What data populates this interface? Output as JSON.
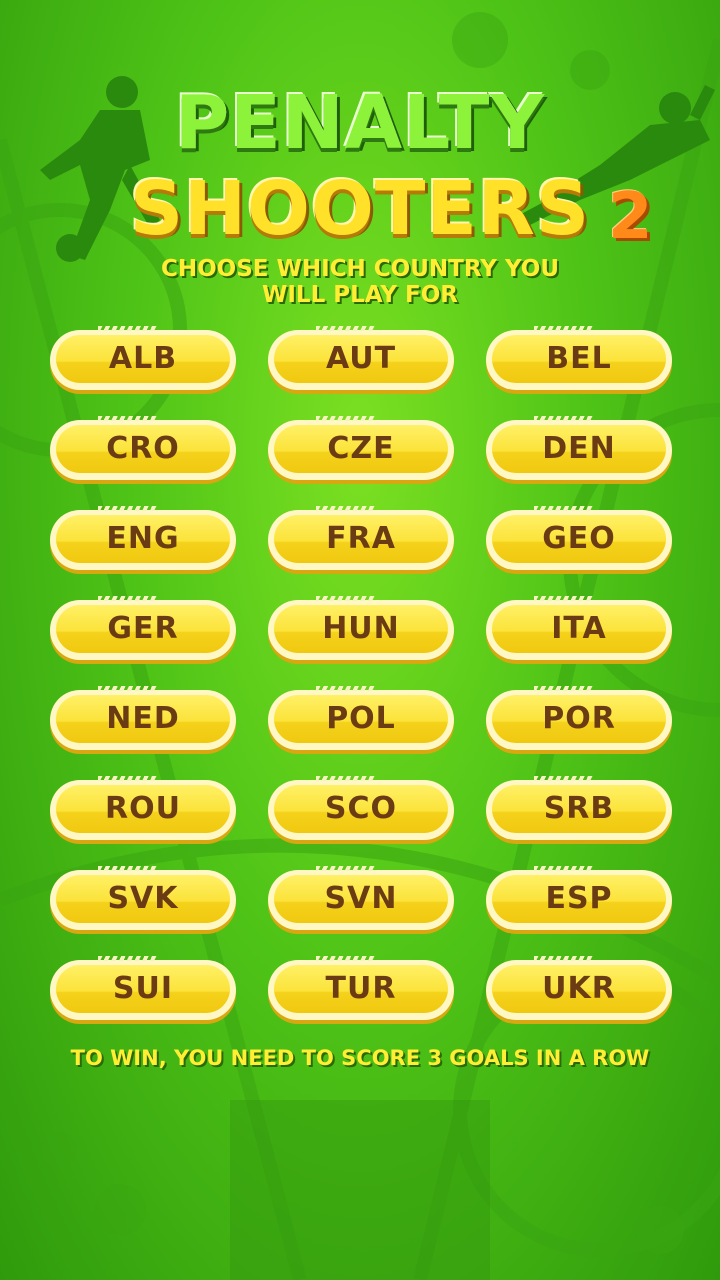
{
  "title": {
    "line1": "PENALTY",
    "line2": "SHOOTERS",
    "number": "2"
  },
  "subtitle_line1": "CHOOSE WHICH COUNTRY YOU",
  "subtitle_line2": "WILL PLAY FOR",
  "countries": [
    "ALB",
    "AUT",
    "BEL",
    "CRO",
    "CZE",
    "DEN",
    "ENG",
    "FRA",
    "GEO",
    "GER",
    "HUN",
    "ITA",
    "NED",
    "POL",
    "POR",
    "ROU",
    "SCO",
    "SRB",
    "SVK",
    "SVN",
    "ESP",
    "SUI",
    "TUR",
    "UKR"
  ],
  "footer": "TO WIN, YOU NEED TO SCORE 3 GOALS IN A ROW",
  "colors": {
    "background": "#4fc417",
    "button_yellow": "#fbe33a",
    "button_text": "#6b3c14",
    "subtitle_yellow": "#ffee33"
  },
  "icons": {
    "left_player": "soccer-player-silhouette-icon",
    "right_player": "goalkeeper-silhouette-icon"
  }
}
